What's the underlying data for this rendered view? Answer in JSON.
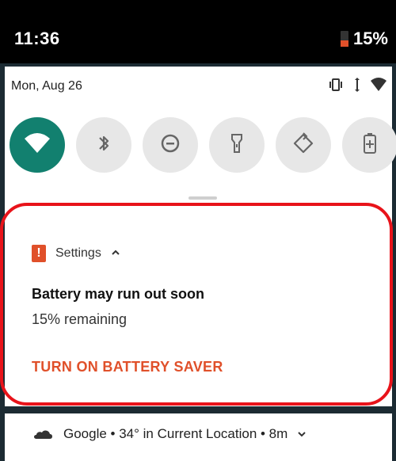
{
  "status_bar": {
    "time": "11:36",
    "battery_percent": "15%",
    "battery_level": 0.15
  },
  "quick_settings": {
    "date": "Mon, Aug 26",
    "tiles": [
      {
        "name": "wifi",
        "active": true
      },
      {
        "name": "bluetooth",
        "active": false
      },
      {
        "name": "do-not-disturb",
        "active": false
      },
      {
        "name": "flashlight",
        "active": false
      },
      {
        "name": "auto-rotate",
        "active": false
      },
      {
        "name": "battery-saver",
        "active": false
      }
    ]
  },
  "notification": {
    "app_name": "Settings",
    "title": "Battery may run out soon",
    "text": "15% remaining",
    "action_label": "TURN ON BATTERY SAVER",
    "accent": "#e0502a",
    "highlight_color": "#e8131a"
  },
  "weather_row": {
    "text": "Google • 34° in Current Location • 8m",
    "icon": "cloud-icon"
  }
}
